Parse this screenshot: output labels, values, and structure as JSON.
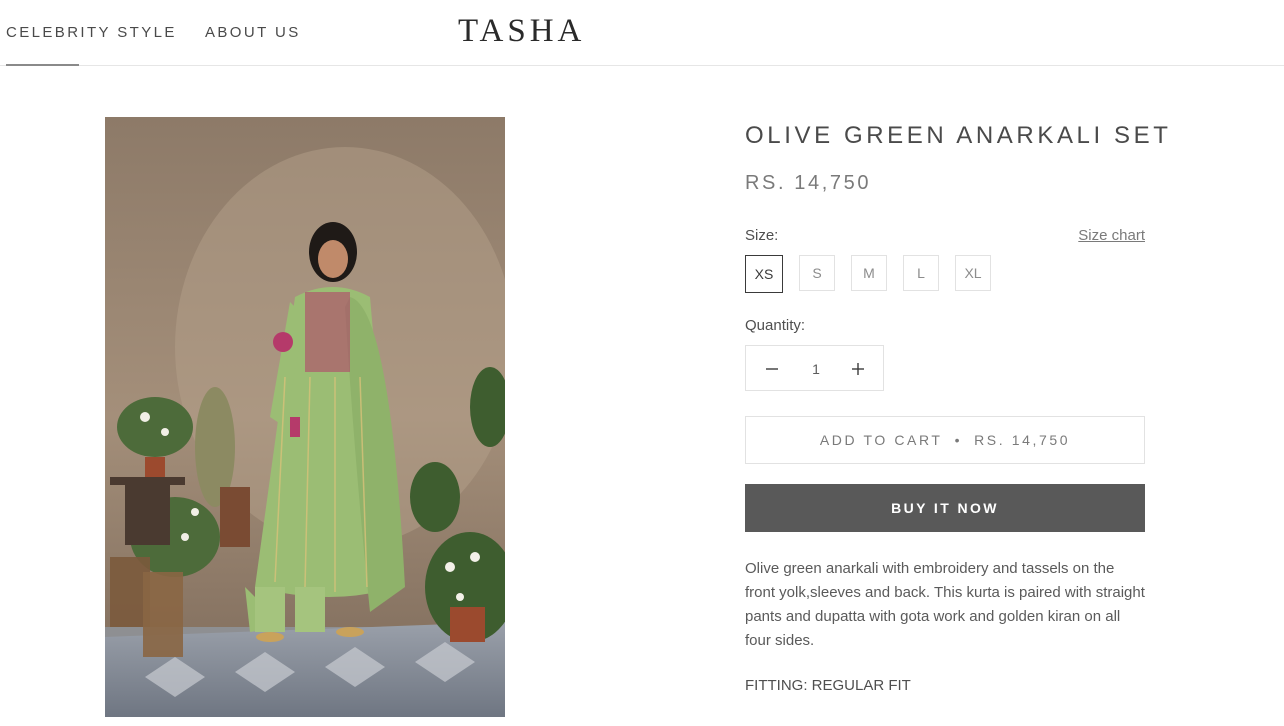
{
  "header": {
    "nav": [
      {
        "label": "CELEBRITY STYLE"
      },
      {
        "label": "ABOUT US"
      }
    ],
    "logo": "TASHA"
  },
  "product": {
    "title": "OLIVE GREEN ANARKALI SET",
    "price": "RS. 14,750",
    "size_label": "Size:",
    "size_chart_label": "Size chart",
    "sizes": [
      "XS",
      "S",
      "M",
      "L",
      "XL"
    ],
    "selected_size": "XS",
    "quantity_label": "Quantity:",
    "quantity": "1",
    "add_to_cart_label": "ADD TO CART",
    "add_to_cart_separator": "•",
    "add_to_cart_price": "RS. 14,750",
    "buy_now_label": "BUY IT NOW",
    "description": "Olive green anarkali with embroidery and tassels on the front yolk,sleeves and back. This kurta is paired with straight pants and dupatta with gota work and golden kiran on all four sides.",
    "fitting": "FITTING: REGULAR FIT"
  },
  "colors": {
    "buy_now_bg": "#595959",
    "border": "#e2e2e2",
    "text": "#5c5c5c"
  }
}
